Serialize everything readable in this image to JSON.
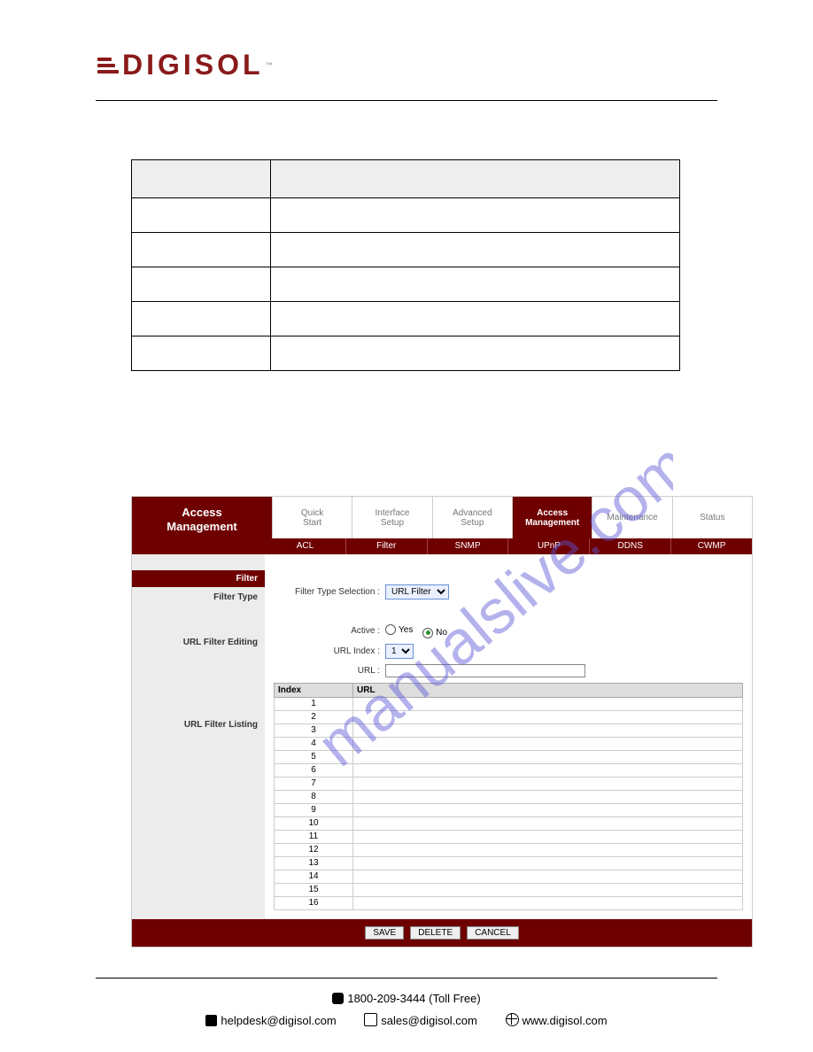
{
  "logo_text": "DIGISOL",
  "watermark": "manualslive.com",
  "router": {
    "title_l1": "Access",
    "title_l2": "Management",
    "tabs": [
      "Quick\nStart",
      "Interface\nSetup",
      "Advanced\nSetup",
      "Access\nManagement",
      "Maintenance",
      "Status"
    ],
    "active_tab_index": 3,
    "subtabs": [
      "ACL",
      "Filter",
      "SNMP",
      "UPnP",
      "DDNS",
      "CWMP"
    ],
    "side": {
      "head": "Filter",
      "s1": "Filter Type",
      "s2": "URL Filter Editing",
      "s3": "URL Filter Listing"
    },
    "form": {
      "filter_type_label": "Filter Type Selection :",
      "filter_type_value": "URL Filter",
      "active_label": "Active :",
      "active_yes": "Yes",
      "active_no": "No",
      "url_index_label": "URL Index :",
      "url_index_value": "1",
      "url_label": "URL :",
      "url_value": ""
    },
    "list": {
      "h1": "Index",
      "h2": "URL",
      "rows": [
        "1",
        "2",
        "3",
        "4",
        "5",
        "6",
        "7",
        "8",
        "9",
        "10",
        "11",
        "12",
        "13",
        "14",
        "15",
        "16"
      ]
    },
    "buttons": {
      "save": "SAVE",
      "delete": "DELETE",
      "cancel": "CANCEL"
    }
  },
  "footer": {
    "phone": "1800-209-3444 (Toll Free)",
    "helpdesk": "helpdesk@digisol.com",
    "sales": "sales@digisol.com",
    "web": "www.digisol.com"
  }
}
